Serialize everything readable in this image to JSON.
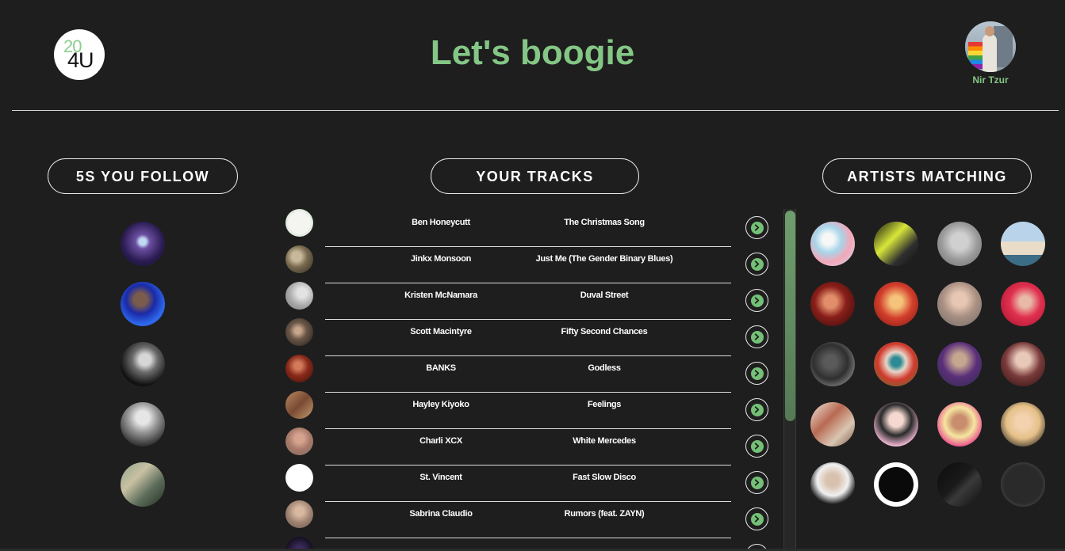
{
  "header": {
    "logo_top": "20",
    "logo_bottom": "4U",
    "title": "Let's boogie",
    "username": "Nir Tzur"
  },
  "sections": {
    "follow_label": "5S YOU FOLLOW",
    "tracks_label": "YOUR TRACKS",
    "artists_label": "ARTISTS MATCHING"
  },
  "colors": {
    "accent": "#84c685",
    "background": "#1e1e1e",
    "button_green": "#74c077"
  },
  "follow": [
    {
      "name": "followed-1",
      "bg": "radial-gradient(circle at 50% 45%, #c2d9f5 0 10%, #6b4fa0 22%, #2b1c52 60%, #13102a 100%)"
    },
    {
      "name": "followed-2",
      "bg": "radial-gradient(circle at 45% 40%, #7a5c4d 0 18%, #1a2aa8 40%, #2f6cf0 70%, #0a0a55 100%)"
    },
    {
      "name": "followed-3",
      "bg": "radial-gradient(circle at 55% 40%, #d6d6d6 0 16%, #6c6c6c 35%, #111 70%)"
    },
    {
      "name": "followed-4",
      "bg": "radial-gradient(circle at 50% 35%, #e6e6e6 0 18%, #9a9a9a 40%, #2a2a2a 80%)"
    },
    {
      "name": "followed-5",
      "bg": "linear-gradient(135deg, #8ea58a 0%, #c9c1a3 35%, #5b6c5a 65%, #273024 100%)"
    }
  ],
  "tracks": [
    {
      "artist": "Ben Honeycutt",
      "song": "The Christmas Song",
      "thumb": "radial-gradient(circle, #f4f4f0 0 55%, #d9e8d9 70%, #c1c1c1 100%)"
    },
    {
      "artist": "Jinkx Monsoon",
      "song": "Just Me (The Gender Binary Blues)",
      "thumb": "radial-gradient(circle at 40% 40%, #c8b89a 0 20%, #7a6a4f 45%, #2b2b22 100%)"
    },
    {
      "artist": "Kristen McNamara",
      "song": "Duval Street",
      "thumb": "radial-gradient(circle at 60% 40%, #e2e2e2 0 20%, #a8a8a8 55%, #7b7b7b 100%)"
    },
    {
      "artist": "Scott Macintyre",
      "song": "Fifty Second Chances",
      "thumb": "radial-gradient(circle at 45% 45%, #c7a68c 0 14%, #6b5748 40%, #1e1a17 100%)"
    },
    {
      "artist": "BANKS",
      "song": "Godless",
      "thumb": "radial-gradient(circle at 45% 40%, #d27a5a 0 16%, #8a2a1a 45%, #3a0e08 100%)"
    },
    {
      "artist": "Hayley Kiyoko",
      "song": "Feelings",
      "thumb": "linear-gradient(135deg, #b98a62 0%, #7a4a33 50%, #c39a6e 100%)"
    },
    {
      "artist": "Charli XCX",
      "song": "White Mercedes",
      "thumb": "radial-gradient(circle at 50% 40%, #d6a38f 0 20%, #a97a6a 50%, #7c6a62 100%)"
    },
    {
      "artist": "St. Vincent",
      "song": "Fast Slow Disco",
      "thumb": "radial-gradient(circle, #ffffff 0 60%, #dddddd 100%)"
    },
    {
      "artist": "Sabrina Claudio",
      "song": "Rumors (feat. ZAYN)",
      "thumb": "radial-gradient(circle at 50% 40%, #d8b8a0 0 20%, #9c8070 55%, #6b5b52 100%)"
    },
    {
      "artist": "",
      "song": "",
      "thumb": "radial-gradient(circle at 50% 50%, #3b2b5e 0 20%, #151020 70%)"
    }
  ],
  "artists": [
    {
      "name": "artist-1",
      "bg": "radial-gradient(circle at 40% 40%, #f7f7f7 0 15%, #a7d6ea 35%, #f2a7b8 60%, #c9dff0 100%)"
    },
    {
      "name": "artist-2",
      "bg": "linear-gradient(135deg, #0e0e0e 0%, #d8e63a 40%, #2f2f2f 70%, #0e0e0e 100%)"
    },
    {
      "name": "artist-3",
      "bg": "radial-gradient(circle at 50% 45%, #d0d0d0 0 25%, #9a9a9a 55%, #6a6a6a 100%)"
    },
    {
      "name": "artist-4",
      "bg": "linear-gradient(#b9d4ea 0 45%, #e9dcc8 45% 75%, #3b6d86 75%)"
    },
    {
      "name": "artist-5",
      "bg": "radial-gradient(circle at 45% 45%, #e28e6a 0 18%, #8a1f1a 45%, #2b0a0a 100%)"
    },
    {
      "name": "artist-6",
      "bg": "radial-gradient(circle at 50% 45%, #f5c37a 0 18%, #d33f2c 50%, #7a140d 100%)"
    },
    {
      "name": "artist-7",
      "bg": "radial-gradient(circle at 50% 40%, #e7c7b3 0 20%, #a88f82 50%, #6f6a68 100%)"
    },
    {
      "name": "artist-8",
      "bg": "radial-gradient(circle at 55% 45%, #e9b9a7 0 16%, #e0304f 45%, #a0102a 100%)"
    },
    {
      "name": "artist-9",
      "bg": "radial-gradient(circle at 45% 45%, #5a5a5a 0 18%, #2f2f2f 50%, #b9b9b9 100%)"
    },
    {
      "name": "artist-10",
      "bg": "radial-gradient(circle at 50% 45%, #2b8a94 0 14%, #e7d6c8 30%, #d23a2d 55%, #3c7d34 100%)"
    },
    {
      "name": "artist-11",
      "bg": "radial-gradient(circle at 50% 40%, #c5a790 0 18%, #5b2f7a 50%, #2d2d4a 100%)"
    },
    {
      "name": "artist-12",
      "bg": "radial-gradient(circle at 50% 40%, #e8c8b8 0 20%, #7a3b3b 50%, #2a1010 100%)"
    },
    {
      "name": "artist-13",
      "bg": "linear-gradient(135deg, #f0e6dc 0%, #b86a52 40%, #d9c6b2 70%, #7a5a48 100%)"
    },
    {
      "name": "artist-14",
      "bg": "radial-gradient(circle at 50% 40%, #f5d8d0 0 20%, #2a2a2a 45%, #f0b8d2 75%)"
    },
    {
      "name": "artist-15",
      "bg": "radial-gradient(circle at 50% 45%, #c98c6c 0 20%, #f5e6a0 45%, #e94c8b 75%, #f7d6a0 100%)"
    },
    {
      "name": "artist-16",
      "bg": "radial-gradient(circle at 50% 45%, #f3d2b0 0 20%, #e5c087 50%, #1a1a1a 90%)"
    },
    {
      "name": "artist-17",
      "bg": "radial-gradient(circle at 50% 40%, #d8c1ae 0 18%, #f0f0f0 45%, #1e1e1e 70%)"
    },
    {
      "name": "artist-18",
      "bg": "radial-gradient(circle, #0a0a0a 0 55%, #ffffff 56% 100%)"
    },
    {
      "name": "artist-19",
      "bg": "linear-gradient(135deg, #0c0c0c 0%, #1a1a1a 45%, #3a3a3a 60%, #0c0c0c 100%)"
    },
    {
      "name": "artist-20",
      "bg": "radial-gradient(circle, #2a2a2a 0 60%, #6a6a6a 100%)"
    }
  ]
}
